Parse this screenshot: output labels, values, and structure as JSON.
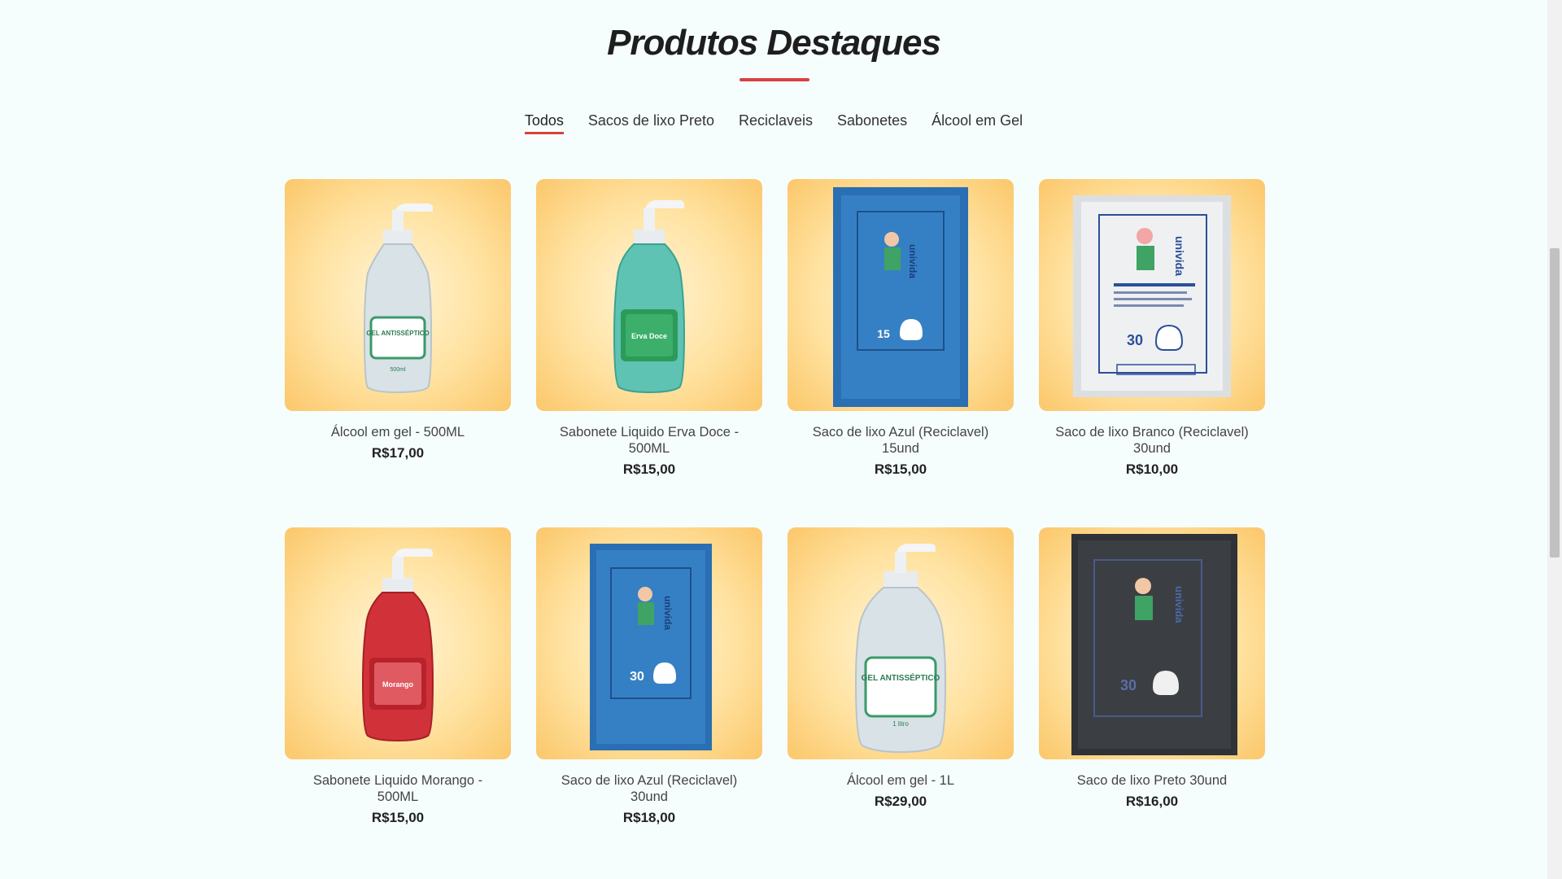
{
  "section": {
    "title": "Produtos Destaques"
  },
  "tabs": [
    {
      "label": "Todos",
      "active": true
    },
    {
      "label": "Sacos de lixo Preto",
      "active": false
    },
    {
      "label": "Reciclaveis",
      "active": false
    },
    {
      "label": "Sabonetes",
      "active": false
    },
    {
      "label": "Álcool em Gel",
      "active": false
    }
  ],
  "products": [
    {
      "name": "Álcool em gel - 500ML",
      "price": "R$17,00",
      "image": "clear-gel-bottle",
      "label_text": "GEL ANTISSÉPTICO",
      "volume": "500ml"
    },
    {
      "name": "Sabonete Liquido Erva Doce - 500ML",
      "price": "R$15,00",
      "image": "green-soap-bottle",
      "label_text": "Erva Doce"
    },
    {
      "name": "Saco de lixo Azul (Reciclavel) 15und",
      "price": "R$15,00",
      "image": "blue-trash-bag",
      "brand": "univida",
      "count": "15"
    },
    {
      "name": "Saco de lixo Branco (Reciclavel) 30und",
      "price": "R$10,00",
      "image": "white-trash-bag",
      "brand": "univida",
      "count": "30"
    },
    {
      "name": "Sabonete Liquido Morango - 500ML",
      "price": "R$15,00",
      "image": "red-soap-bottle",
      "label_text": "Morango"
    },
    {
      "name": "Saco de lixo Azul (Reciclavel) 30und",
      "price": "R$18,00",
      "image": "blue-trash-bag",
      "brand": "univida",
      "count": "30"
    },
    {
      "name": "Álcool em gel - 1L",
      "price": "R$29,00",
      "image": "large-gel-bottle",
      "label_text": "GEL ANTISSÉPTICO",
      "volume": "1 litro"
    },
    {
      "name": "Saco de lixo Preto 30und",
      "price": "R$16,00",
      "image": "black-trash-bag",
      "brand": "univida",
      "count": "30"
    }
  ],
  "colors": {
    "accent": "#d94040",
    "background": "#f6fdfd",
    "card_bg": "#ffe2a0"
  }
}
